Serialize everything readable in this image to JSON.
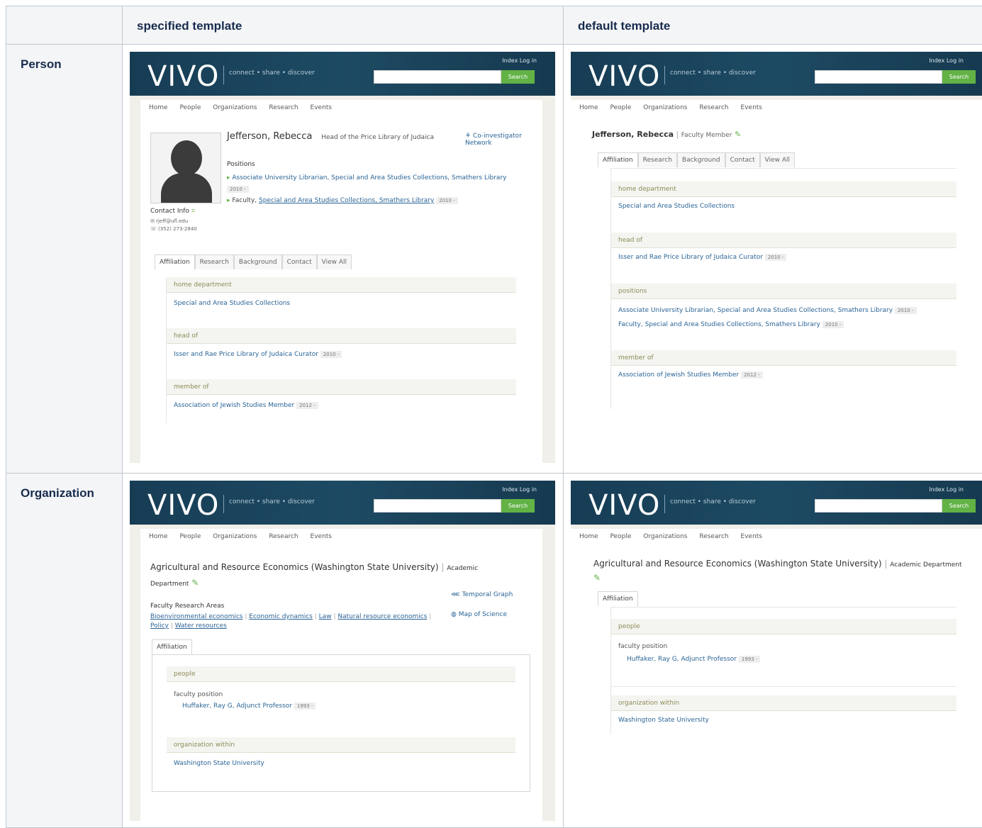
{
  "headers": [
    "",
    "specified template",
    "default template"
  ],
  "rows": [
    {
      "label": "Person"
    },
    {
      "label": "Organization"
    }
  ],
  "vivo": {
    "logo": "VIVO",
    "tagline": "connect • share • discover",
    "toplinks": "Index   Log in",
    "search_button": "Search",
    "nav": [
      "Home",
      "People",
      "Organizations",
      "Research",
      "Events"
    ]
  },
  "person": {
    "name": "Jefferson, Rebecca",
    "title": "Head of the Price Library of Judaica",
    "positions_label": "Positions",
    "position_1": "Associate University Librarian, Special and Area Studies Collections, Smathers Library",
    "position_1_date": "2010 -",
    "position_2_prefix": "Faculty, ",
    "position_2_link": "Special and Area Studies Collections, Smathers Library",
    "position_2_date": "2010 -",
    "coinvestigator": "Co-investigator Network",
    "contact_label": "Contact Info",
    "contact_email": "rjeff@ufl.edu",
    "contact_phone": "(352) 273-2840",
    "tabs": [
      "Affiliation",
      "Research",
      "Background",
      "Contact",
      "View All"
    ],
    "home_dept_label": "home department",
    "home_dept": "Special and Area Studies Collections",
    "head_of_label": "head of",
    "head_of": "Isser and Rae Price Library of Judaica Curator",
    "head_of_date": "2010 -",
    "member_of_label": "member of",
    "member_of": "Association of Jewish Studies Member",
    "member_of_date": "2012 -"
  },
  "person_default": {
    "name": "Jefferson, Rebecca",
    "type": "Faculty Member",
    "tabs": [
      "Affiliation",
      "Research",
      "Background",
      "Contact",
      "View All"
    ],
    "home_dept_label": "home department",
    "home_dept": "Special and Area Studies Collections",
    "head_of_label": "head of",
    "head_of": "Isser and Rae Price Library of Judaica Curator",
    "head_of_date": "2010 -",
    "positions_label": "positions",
    "position_1": "Associate University Librarian, Special and Area Studies Collections, Smathers Library",
    "position_1_date": "2010 -",
    "position_2": "Faculty, Special and Area Studies Collections, Smathers Library",
    "position_2_date": "2010 -",
    "member_of_label": "member of",
    "member_of": "Association of Jewish Studies Member",
    "member_of_date": "2012 -"
  },
  "org": {
    "name": "Agricultural and Resource Economics (Washington State University)",
    "type": "Academic Department",
    "temporal": "Temporal Graph",
    "map": "Map of Science",
    "research_areas_label": "Faculty Research Areas",
    "research_areas": [
      "Bioenvironmental economics",
      "Economic dynamics",
      "Law",
      "Natural resource economics",
      "Policy",
      "Water resources"
    ],
    "tab": "Affiliation",
    "people_label": "people",
    "faculty_position_label": "faculty position",
    "person": "Huffaker, Ray G, Adjunct Professor",
    "person_date": "1993 -",
    "within_label": "organization within",
    "within": "Washington State University"
  }
}
